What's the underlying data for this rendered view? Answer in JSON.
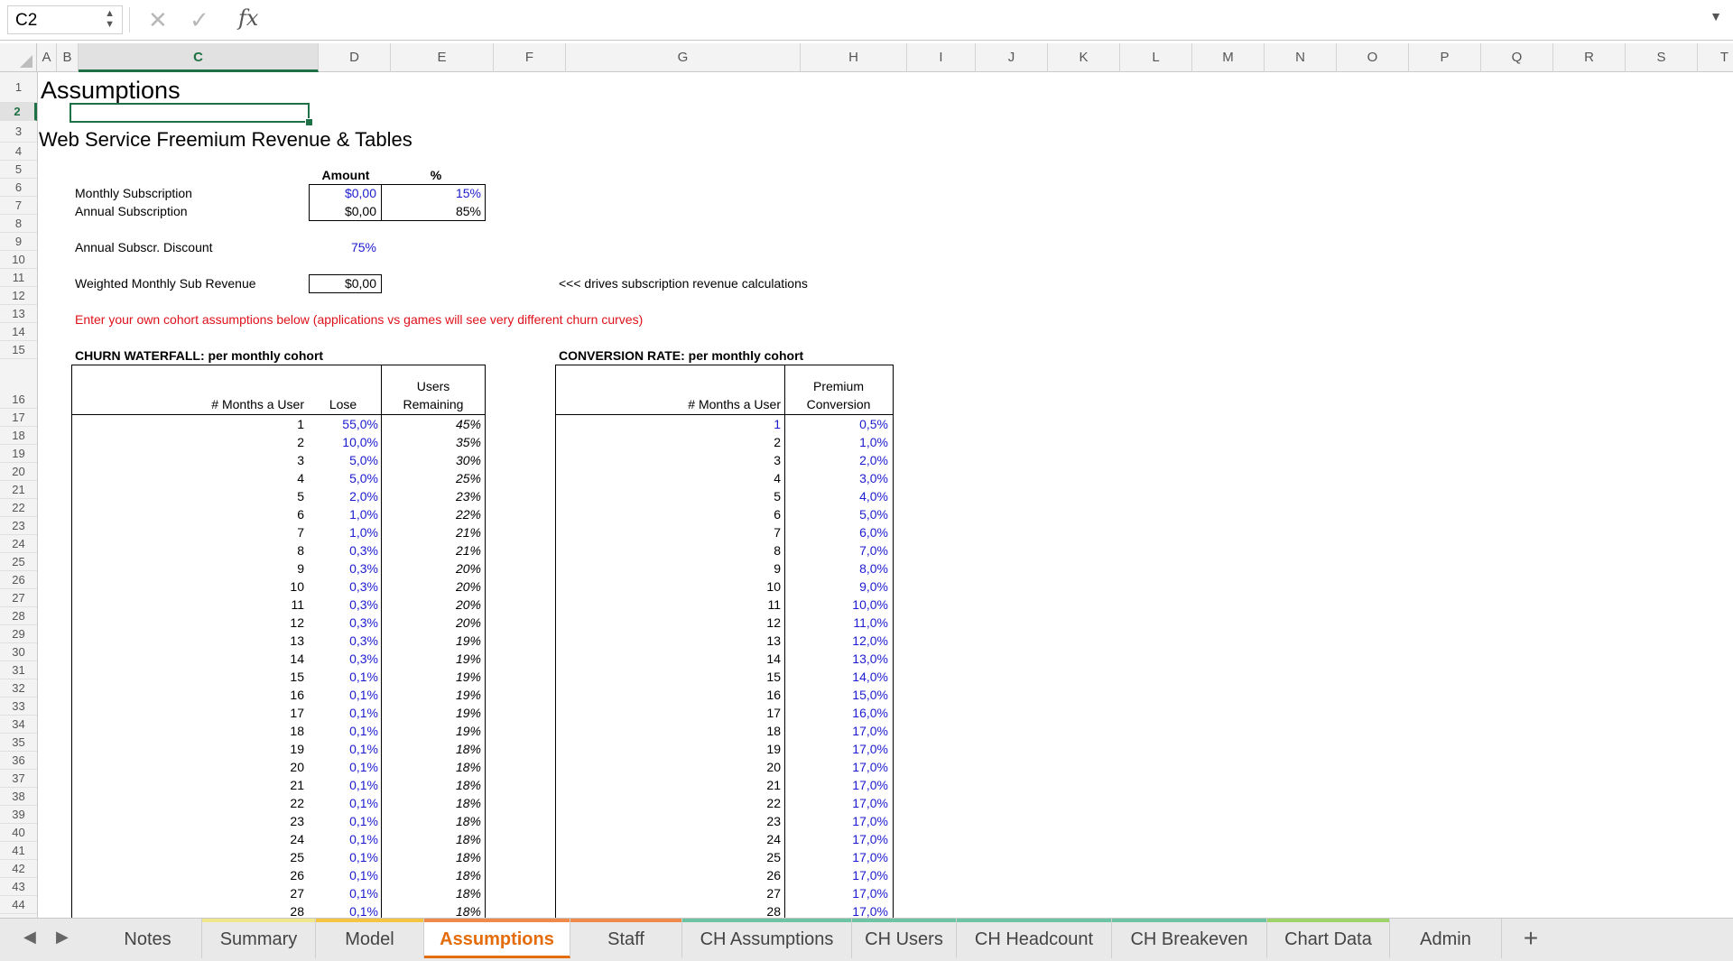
{
  "formula_bar": {
    "name_box": "C2",
    "cancel_icon": "✕",
    "confirm_icon": "✓",
    "fx_icon": "fx",
    "formula": ""
  },
  "columns": [
    "A",
    "B",
    "C",
    "D",
    "E",
    "F",
    "G",
    "H",
    "I",
    "J",
    "K",
    "L",
    "M",
    "N",
    "O",
    "P",
    "Q",
    "R",
    "S",
    "T"
  ],
  "rows": [
    "1",
    "2",
    "3",
    "4",
    "5",
    "6",
    "7",
    "8",
    "9",
    "10",
    "11",
    "12",
    "13",
    "14",
    "15",
    "16",
    "17",
    "18",
    "19",
    "20",
    "21",
    "22",
    "23",
    "24",
    "25",
    "26",
    "27",
    "28",
    "29",
    "30",
    "31",
    "32",
    "33",
    "34",
    "35",
    "36",
    "37",
    "38",
    "39",
    "40",
    "41",
    "42",
    "43",
    "44"
  ],
  "sheet": {
    "title": "Assumptions",
    "subtitle": "Web Service Freemium Revenue & Tables",
    "amount_header": "Amount",
    "pct_header": "%",
    "monthly_label": "Monthly Subscription",
    "monthly_amount": "$0,00",
    "monthly_pct": "15%",
    "annual_label": "Annual Subscription",
    "annual_amount": "$0,00",
    "annual_pct": "85%",
    "discount_label": "Annual Subscr. Discount",
    "discount_value": "75%",
    "weighted_label": "Weighted Monthly Sub Revenue",
    "weighted_value": "$0,00",
    "weighted_note": "<<< drives subscription revenue calculations",
    "cohort_note": "Enter your own cohort assumptions below (applications vs games will see very different churn curves)",
    "churn_title": "CHURN WATERFALL: per monthly cohort",
    "churn_hdr_months": "# Months a User",
    "churn_hdr_lose": "Lose",
    "churn_hdr_users_1": "Users",
    "churn_hdr_users_2": "Remaining",
    "conv_title": "CONVERSION RATE: per monthly cohort",
    "conv_hdr_months": "# Months a User",
    "conv_hdr_1": "Premium",
    "conv_hdr_2": "Conversion"
  },
  "churn_rows": [
    {
      "m": "1",
      "lose": "55,0%",
      "rem": "45%"
    },
    {
      "m": "2",
      "lose": "10,0%",
      "rem": "35%"
    },
    {
      "m": "3",
      "lose": "5,0%",
      "rem": "30%"
    },
    {
      "m": "4",
      "lose": "5,0%",
      "rem": "25%"
    },
    {
      "m": "5",
      "lose": "2,0%",
      "rem": "23%"
    },
    {
      "m": "6",
      "lose": "1,0%",
      "rem": "22%"
    },
    {
      "m": "7",
      "lose": "1,0%",
      "rem": "21%"
    },
    {
      "m": "8",
      "lose": "0,3%",
      "rem": "21%"
    },
    {
      "m": "9",
      "lose": "0,3%",
      "rem": "20%"
    },
    {
      "m": "10",
      "lose": "0,3%",
      "rem": "20%"
    },
    {
      "m": "11",
      "lose": "0,3%",
      "rem": "20%"
    },
    {
      "m": "12",
      "lose": "0,3%",
      "rem": "20%"
    },
    {
      "m": "13",
      "lose": "0,3%",
      "rem": "19%"
    },
    {
      "m": "14",
      "lose": "0,3%",
      "rem": "19%"
    },
    {
      "m": "15",
      "lose": "0,1%",
      "rem": "19%"
    },
    {
      "m": "16",
      "lose": "0,1%",
      "rem": "19%"
    },
    {
      "m": "17",
      "lose": "0,1%",
      "rem": "19%"
    },
    {
      "m": "18",
      "lose": "0,1%",
      "rem": "19%"
    },
    {
      "m": "19",
      "lose": "0,1%",
      "rem": "18%"
    },
    {
      "m": "20",
      "lose": "0,1%",
      "rem": "18%"
    },
    {
      "m": "21",
      "lose": "0,1%",
      "rem": "18%"
    },
    {
      "m": "22",
      "lose": "0,1%",
      "rem": "18%"
    },
    {
      "m": "23",
      "lose": "0,1%",
      "rem": "18%"
    },
    {
      "m": "24",
      "lose": "0,1%",
      "rem": "18%"
    },
    {
      "m": "25",
      "lose": "0,1%",
      "rem": "18%"
    },
    {
      "m": "26",
      "lose": "0,1%",
      "rem": "18%"
    },
    {
      "m": "27",
      "lose": "0,1%",
      "rem": "18%"
    },
    {
      "m": "28",
      "lose": "0,1%",
      "rem": "18%"
    }
  ],
  "conv_rows": [
    {
      "m": "1",
      "c": "0,5%"
    },
    {
      "m": "2",
      "c": "1,0%"
    },
    {
      "m": "3",
      "c": "2,0%"
    },
    {
      "m": "4",
      "c": "3,0%"
    },
    {
      "m": "5",
      "c": "4,0%"
    },
    {
      "m": "6",
      "c": "5,0%"
    },
    {
      "m": "7",
      "c": "6,0%"
    },
    {
      "m": "8",
      "c": "7,0%"
    },
    {
      "m": "9",
      "c": "8,0%"
    },
    {
      "m": "10",
      "c": "9,0%"
    },
    {
      "m": "11",
      "c": "10,0%"
    },
    {
      "m": "12",
      "c": "11,0%"
    },
    {
      "m": "13",
      "c": "12,0%"
    },
    {
      "m": "14",
      "c": "13,0%"
    },
    {
      "m": "15",
      "c": "14,0%"
    },
    {
      "m": "16",
      "c": "15,0%"
    },
    {
      "m": "17",
      "c": "16,0%"
    },
    {
      "m": "18",
      "c": "17,0%"
    },
    {
      "m": "19",
      "c": "17,0%"
    },
    {
      "m": "20",
      "c": "17,0%"
    },
    {
      "m": "21",
      "c": "17,0%"
    },
    {
      "m": "22",
      "c": "17,0%"
    },
    {
      "m": "23",
      "c": "17,0%"
    },
    {
      "m": "24",
      "c": "17,0%"
    },
    {
      "m": "25",
      "c": "17,0%"
    },
    {
      "m": "26",
      "c": "17,0%"
    },
    {
      "m": "27",
      "c": "17,0%"
    },
    {
      "m": "28",
      "c": "17,0%"
    }
  ],
  "tabs": [
    {
      "label": "Notes",
      "color": ""
    },
    {
      "label": "Summary",
      "color": "#f0e68c"
    },
    {
      "label": "Model",
      "color": "#f5c542"
    },
    {
      "label": "Assumptions",
      "color": "#f08a4b",
      "active": true
    },
    {
      "label": "Staff",
      "color": "#f08a4b"
    },
    {
      "label": "CH Assumptions",
      "color": "#6cc4a4"
    },
    {
      "label": "CH Users",
      "color": "#6cc4a4"
    },
    {
      "label": "CH Headcount",
      "color": "#6cc4a4"
    },
    {
      "label": "CH Breakeven",
      "color": "#6cc4a4"
    },
    {
      "label": "Chart Data",
      "color": "#9ed36a"
    },
    {
      "label": "Admin",
      "color": ""
    }
  ],
  "add_tab": "+",
  "nav_prev": "◀",
  "nav_next": "▶"
}
